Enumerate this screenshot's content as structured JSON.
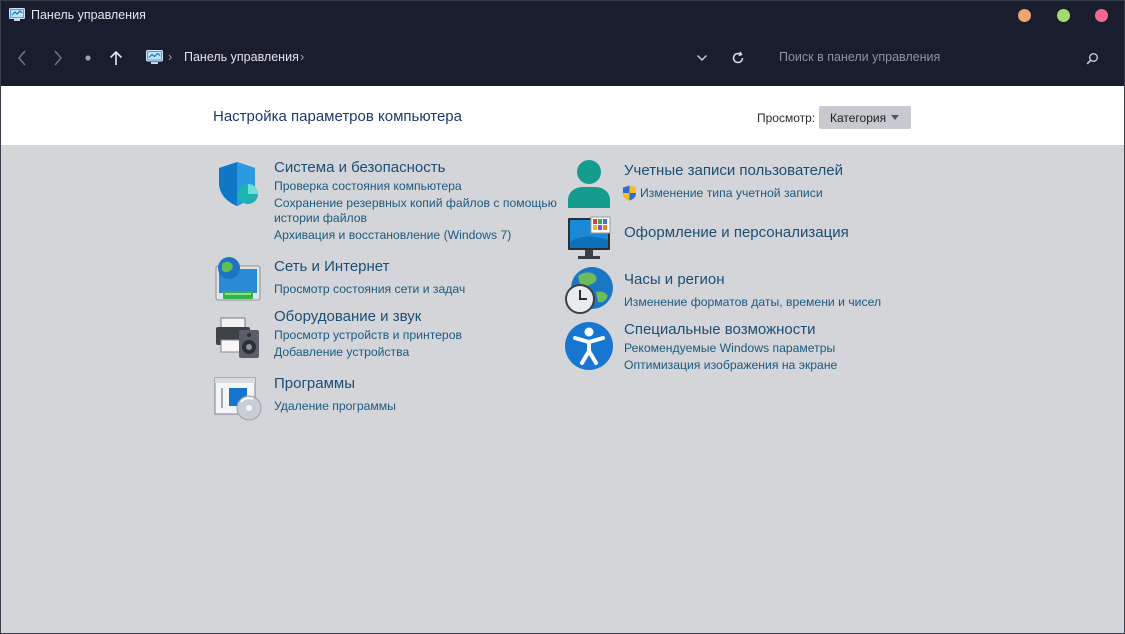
{
  "window": {
    "title": "Панель управления",
    "controls": {
      "minimize_color": "#f1a46c",
      "maximize_color": "#a7d96a",
      "close_color": "#f06b8d"
    }
  },
  "navigation": {
    "breadcrumb_label": "Панель управления",
    "search_placeholder": "Поиск в панели управления"
  },
  "header": {
    "title": "Настройка параметров компьютера",
    "view_label": "Просмотр:",
    "view_value": "Категория"
  },
  "categories": [
    {
      "title": "Система и безопасность",
      "icon": "shield-icon",
      "links": [
        "Проверка состояния компьютера",
        "Сохранение резервных копий файлов с помощью",
        "истории файлов",
        "Архивация и восстановление (Windows 7)"
      ]
    },
    {
      "title": "Сеть и Интернет",
      "icon": "network-globe-icon",
      "links": [
        "Просмотр состояния сети и задач"
      ]
    },
    {
      "title": "Оборудование и звук",
      "icon": "printer-speaker-icon",
      "links": [
        "Просмотр устройств и принтеров",
        "Добавление устройства"
      ]
    },
    {
      "title": "Программы",
      "icon": "programs-disc-icon",
      "links": [
        "Удаление программы"
      ]
    },
    {
      "title": "Учетные записи пользователей",
      "icon": "user-account-icon",
      "links": [
        "Изменение типа учетной записи"
      ]
    },
    {
      "title": "Оформление и персонализация",
      "icon": "monitor-personalization-icon",
      "links": []
    },
    {
      "title": "Часы и регион",
      "icon": "globe-clock-icon",
      "links": [
        "Изменение форматов даты, времени и чисел"
      ]
    },
    {
      "title": "Специальные возможности",
      "icon": "accessibility-icon",
      "links": [
        "Рекомендуемые Windows параметры",
        "Оптимизация изображения на экране"
      ]
    }
  ]
}
